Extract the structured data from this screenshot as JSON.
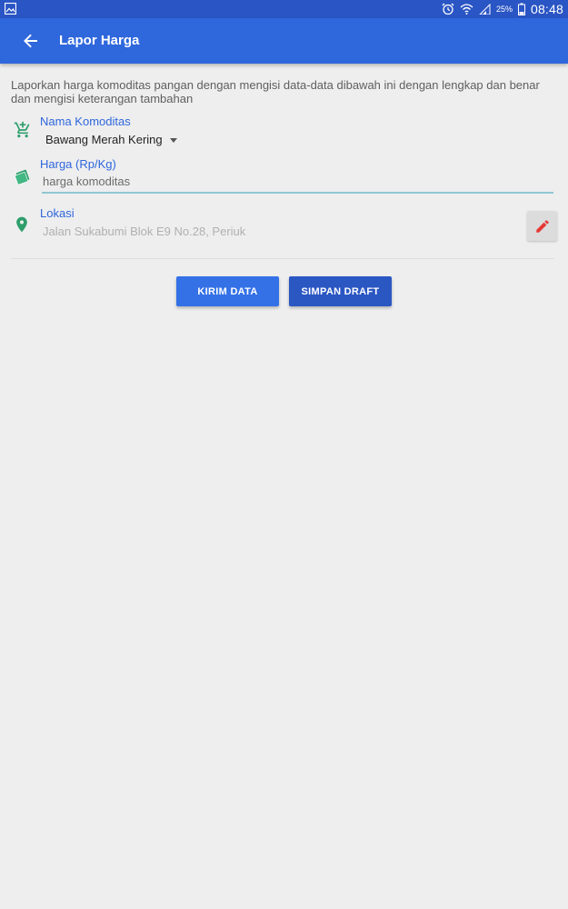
{
  "status_bar": {
    "battery_percent": "25%",
    "time": "08:48",
    "icons": [
      "gallery-icon",
      "alarm-icon",
      "wifi-icon",
      "signal-icon",
      "battery-icon"
    ]
  },
  "app_bar": {
    "title": "Lapor Harga",
    "back_icon": "arrow-back-icon"
  },
  "form": {
    "description": "Laporkan harga komoditas pangan dengan mengisi data-data dibawah ini dengan lengkap dan benar dan mengisi keterangan tambahan",
    "commodity": {
      "label": "Nama Komoditas",
      "icon": "cart-add-icon",
      "selected_value": "Bawang Merah Kering"
    },
    "price": {
      "label": "Harga (Rp/Kg)",
      "icon": "money-icon",
      "placeholder": "harga komoditas",
      "value": ""
    },
    "location": {
      "label": "Lokasi",
      "icon": "location-pin-icon",
      "value": "Jalan Sukabumi Blok E9 No.28, Periuk",
      "edit_icon": "pencil-icon"
    }
  },
  "actions": {
    "send_label": "KIRIM DATA",
    "draft_label": "SIMPAN DRAFT"
  },
  "colors": {
    "primary": "#2f67dc",
    "status_bar": "#2a55c4",
    "icon_green": "#2e9e6b",
    "edit_red": "#e53935",
    "background": "#eeeeef"
  }
}
